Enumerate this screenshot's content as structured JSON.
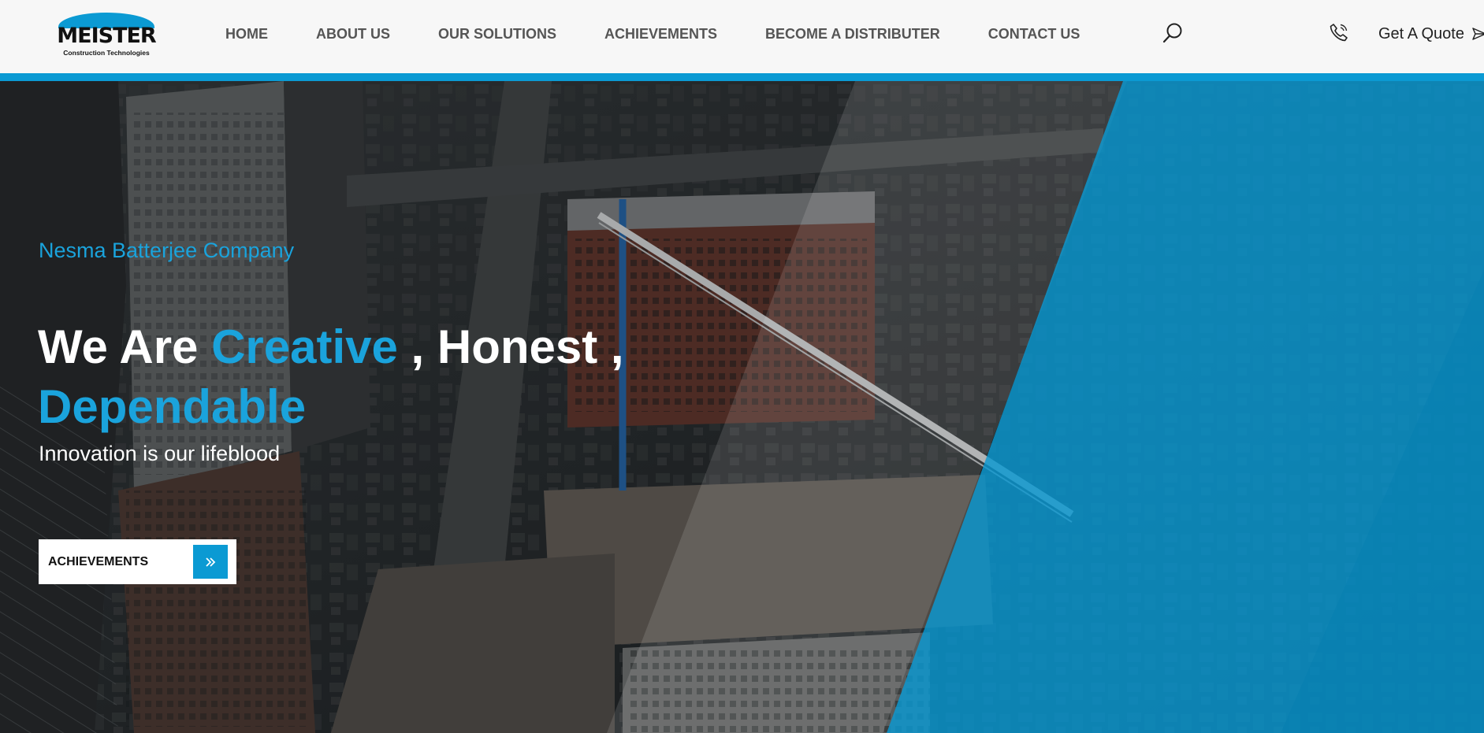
{
  "header": {
    "logo": {
      "name": "MEISTER",
      "subtitle": "Construction Technologies"
    },
    "nav": [
      {
        "label": "HOME"
      },
      {
        "label": "ABOUT US"
      },
      {
        "label": "OUR SOLUTIONS"
      },
      {
        "label": "ACHIEVEMENTS"
      },
      {
        "label": "BECOME A DISTRIBUTER"
      },
      {
        "label": "CONTACT US"
      }
    ],
    "quote_label": "Get A Quote",
    "icons": {
      "search": "search-icon",
      "phone": "phone-icon",
      "send": "send-icon"
    }
  },
  "hero": {
    "eyebrow": "Nesma Batterjee Company",
    "title": {
      "part1": "We Are ",
      "accent1": "Creative",
      "part2": " , Honest ,",
      "accent2": "Dependable"
    },
    "subtitle": "Innovation is our lifeblood",
    "cta_label": "ACHIEVEMENTS",
    "cta_icon": "double-chevron-right-icon"
  },
  "colors": {
    "accent": "#0b9ad3",
    "accent_text": "#1aa3dc",
    "header_bg": "#f7f7f7"
  }
}
